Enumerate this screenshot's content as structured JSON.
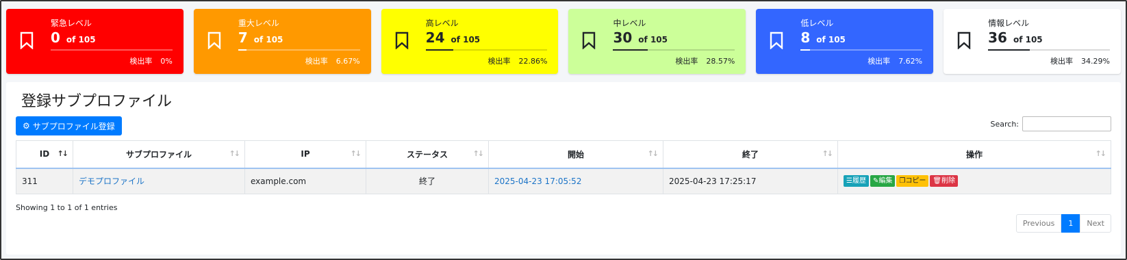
{
  "cards": [
    {
      "name": "緊急レベル",
      "count": "0",
      "of": "of 105",
      "rate_label": "検出率",
      "rate": "0%",
      "progress": 0.0,
      "bg": "#ff0000",
      "fg": "#ffffff"
    },
    {
      "name": "重大レベル",
      "count": "7",
      "of": "of 105",
      "rate_label": "検出率",
      "rate": "6.67%",
      "progress": 0.0667,
      "bg": "#ff9900",
      "fg": "#ffffff"
    },
    {
      "name": "高レベル",
      "count": "24",
      "of": "of 105",
      "rate_label": "検出率",
      "rate": "22.86%",
      "progress": 0.2286,
      "bg": "#ffff00",
      "fg": "#212529"
    },
    {
      "name": "中レベル",
      "count": "30",
      "of": "of 105",
      "rate_label": "検出率",
      "rate": "28.57%",
      "progress": 0.2857,
      "bg": "#ccff99",
      "fg": "#212529"
    },
    {
      "name": "低レベル",
      "count": "8",
      "of": "of 105",
      "rate_label": "検出率",
      "rate": "7.62%",
      "progress": 0.0762,
      "bg": "#3366ff",
      "fg": "#ffffff"
    },
    {
      "name": "情報レベル",
      "count": "36",
      "of": "of 105",
      "rate_label": "検出率",
      "rate": "34.29%",
      "progress": 0.3429,
      "bg": "#ffffff",
      "fg": "#212529"
    }
  ],
  "panel": {
    "title": "登録サブプロファイル",
    "add_button": "サブプロファイル登録",
    "search_label": "Search:",
    "search_value": ""
  },
  "table": {
    "columns": [
      "ID",
      "サブプロファイル",
      "IP",
      "ステータス",
      "開始",
      "終了",
      "操作"
    ],
    "rows": [
      {
        "id": "311",
        "profile": "デモプロファイル",
        "ip": "example.com",
        "status": "終了",
        "start": "2025-04-23 17:05:52",
        "end": "2025-04-23 17:25:17"
      }
    ],
    "actions": {
      "history": "履歴",
      "edit": "編集",
      "copy": "コピー",
      "delete": "削除"
    }
  },
  "info": "Showing 1 to 1 of 1 entries",
  "pager": {
    "previous": "Previous",
    "current": "1",
    "next": "Next"
  }
}
